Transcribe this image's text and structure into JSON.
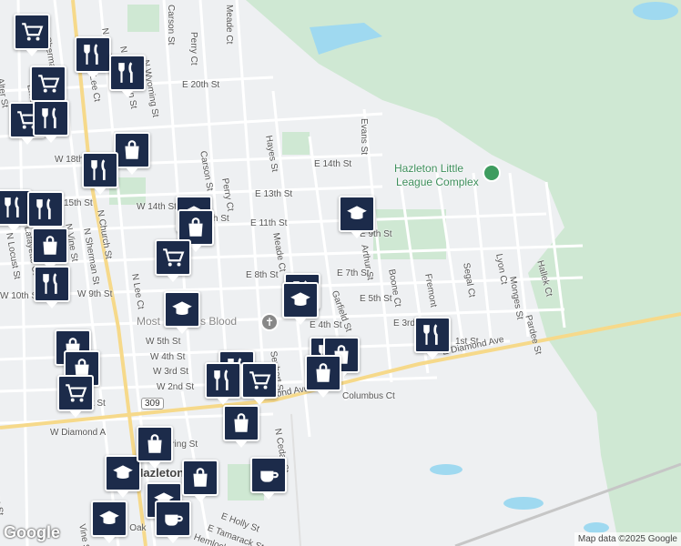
{
  "map": {
    "attribution": "Map data ©2025 Google",
    "logo": "Google",
    "colors": {
      "park": "#cfe8d3",
      "water": "#9fd9f0",
      "road": "#ffffff",
      "major_road": "#f6d98a",
      "rail": "#c6c6c6",
      "poi": "#1c2b4a"
    }
  },
  "places": {
    "league_complex_line1": "Hazleton Little",
    "league_complex_line2": "League Complex",
    "church": "Most Precious Blood",
    "city": "Hazleton"
  },
  "streets": [
    "Carson St",
    "Meade Ct",
    "Perry Ct",
    "N Sherman St",
    "N Laurel St",
    "N Manhattan St",
    "N Wyoming St",
    "E 20th St",
    "N Lee Ct",
    "Alter St",
    "Emerald",
    "Hayes St",
    "Evans St",
    "E 14th St",
    "W 18th St",
    "Carson St",
    "Perry Ct",
    "E 13th St",
    "W 14th St",
    "15th St",
    "N Church St",
    "N Sherman St",
    "N Vine St",
    "Lafayette Ct",
    "N Locust St",
    "E 11th St",
    "12th St",
    "Meade Ct",
    "E 9th St",
    "Arthur St",
    "W 10th St",
    "W 9th St",
    "N Lee Ct",
    "E 8th St",
    "E 7th St",
    "Garfield St",
    "E 5th St",
    "Boone Ct",
    "Fremont",
    "Segal Ct",
    "Lyon Ct",
    "Monges St",
    "Hallek Ct",
    "Pardee St",
    "E 3rd",
    "1st St",
    "E 4th St",
    "Mea",
    "W 5th St",
    "W 4th St",
    "W 3rd St",
    "W 2nd St",
    "Seybert St",
    "W 1st St",
    "E Diamond Ave",
    "Diamond Ave",
    "Columbus Ct",
    "W Diamond A",
    "Spring St",
    "N Cedar St",
    "E Holly St",
    "E Tamarack St",
    "Hemlock",
    "W Oak",
    "Vine St",
    "mes St"
  ],
  "highway_shield": "309",
  "pins": [
    {
      "icon": "cart-icon"
    },
    {
      "icon": "fork-knife-icon"
    },
    {
      "icon": "fork-knife-icon"
    },
    {
      "icon": "cart-icon"
    },
    {
      "icon": "cart-icon"
    },
    {
      "icon": "fork-knife-icon"
    },
    {
      "icon": "bag-icon"
    },
    {
      "icon": "fork-knife-icon"
    },
    {
      "icon": "fork-knife-icon"
    },
    {
      "icon": "fork-knife-icon"
    },
    {
      "icon": "bag-icon"
    },
    {
      "icon": "fork-knife-icon"
    },
    {
      "icon": "school-icon"
    },
    {
      "icon": "school-icon"
    },
    {
      "icon": "bag-icon"
    },
    {
      "icon": "cart-icon"
    },
    {
      "icon": "school-icon"
    },
    {
      "icon": "fork-knife-icon"
    },
    {
      "icon": "school-icon"
    },
    {
      "icon": "fork-knife-icon"
    },
    {
      "icon": "fork-knife-icon"
    },
    {
      "icon": "bag-icon"
    },
    {
      "icon": "bag-icon"
    },
    {
      "icon": "bag-icon"
    },
    {
      "icon": "cart-icon"
    },
    {
      "icon": "fork-knife-icon"
    },
    {
      "icon": "fork-knife-icon"
    },
    {
      "icon": "cart-icon"
    },
    {
      "icon": "bag-icon"
    },
    {
      "icon": "bag-icon"
    },
    {
      "icon": "school-icon"
    },
    {
      "icon": "bag-icon"
    },
    {
      "icon": "coffee-icon"
    },
    {
      "icon": "school-icon"
    },
    {
      "icon": "school-icon"
    },
    {
      "icon": "coffee-icon"
    },
    {
      "icon": "bag-icon"
    }
  ]
}
